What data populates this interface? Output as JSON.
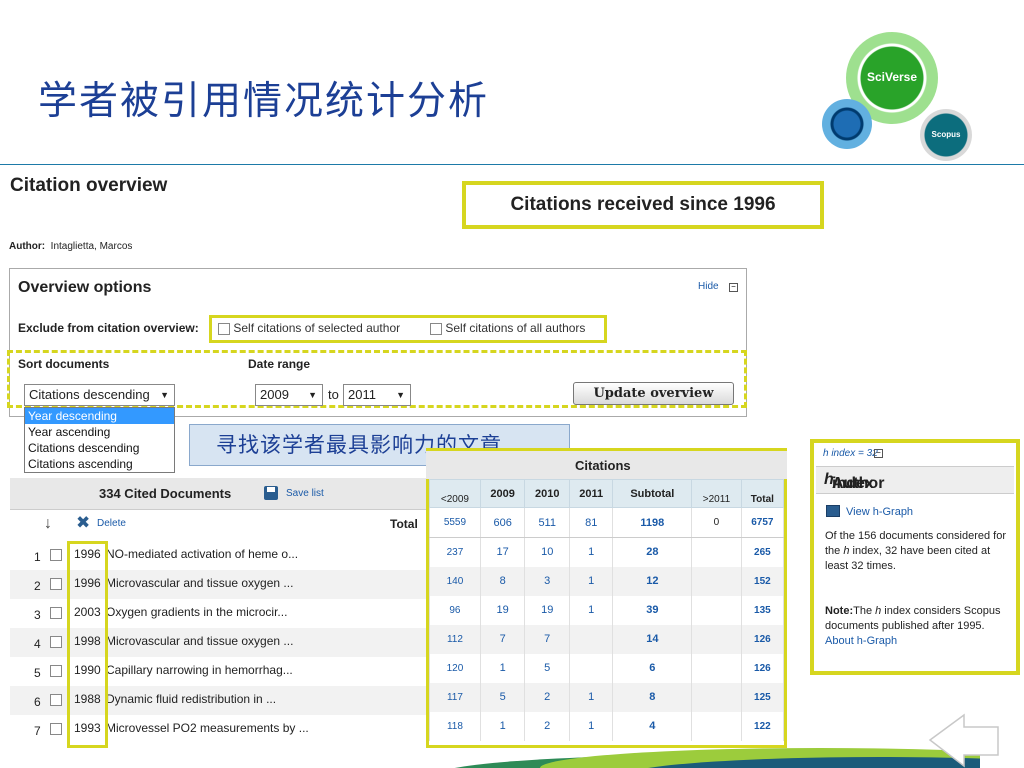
{
  "slide": {
    "title": "学者被引用情况统计分析"
  },
  "logos": {
    "big": "SciVerse",
    "small": "Scopus"
  },
  "page": {
    "heading": "Citation overview",
    "received_since": "Citations received since 1996",
    "author_label": "Author:",
    "author_name": "Intaglietta, Marcos"
  },
  "options": {
    "title": "Overview options",
    "hide_label": "Hide",
    "hide_icon": "minus-box-icon",
    "exclude_label": "Exclude from citation overview:",
    "self_selected": "Self citations of selected author",
    "self_all": "Self citations of all authors",
    "sort_label": "Sort documents",
    "date_label": "Date range",
    "sort_value": "Citations descending",
    "date_from": "2009",
    "date_to_label": "to",
    "date_to": "2011",
    "update_button": "Update overview",
    "dropdown_options": [
      "Year descending",
      "Year ascending",
      "Citations descending",
      "Citations ascending"
    ],
    "dropdown_selected_index": 0
  },
  "callout": {
    "text": "寻找该学者最具影响力的文章"
  },
  "documents": {
    "count_label": "334 Cited Documents",
    "save_label": "Save list",
    "delete_label": "Delete",
    "total_label": "Total",
    "rows": [
      {
        "num": "1",
        "year": "1996",
        "title": "NO-mediated activation of heme o..."
      },
      {
        "num": "2",
        "year": "1996",
        "title": "Microvascular and tissue oxygen ..."
      },
      {
        "num": "3",
        "year": "2003",
        "title": "Oxygen gradients in the microcir..."
      },
      {
        "num": "4",
        "year": "1998",
        "title": "Microvascular and tissue oxygen ..."
      },
      {
        "num": "5",
        "year": "1990",
        "title": "Capillary narrowing in hemorrhag..."
      },
      {
        "num": "6",
        "year": "1988",
        "title": "Dynamic fluid redistribution in ..."
      },
      {
        "num": "7",
        "year": "1993",
        "title": "Microvessel PO2 measurements by ..."
      }
    ]
  },
  "citations": {
    "caption": "Citations",
    "headers": [
      "<2009",
      "2009",
      "2010",
      "2011",
      "Subtotal",
      ">2011",
      "Total"
    ],
    "totals": [
      "5559",
      "606",
      "511",
      "81",
      "1198",
      "0",
      "6757"
    ],
    "rows": [
      [
        "237",
        "17",
        "10",
        "1",
        "28",
        "",
        "265"
      ],
      [
        "140",
        "8",
        "3",
        "1",
        "12",
        "",
        "152"
      ],
      [
        "96",
        "19",
        "19",
        "1",
        "39",
        "",
        "135"
      ],
      [
        "112",
        "7",
        "7",
        "",
        "14",
        "",
        "126"
      ],
      [
        "120",
        "1",
        "5",
        "",
        "6",
        "",
        "126"
      ],
      [
        "117",
        "5",
        "2",
        "1",
        "8",
        "",
        "125"
      ],
      [
        "118",
        "1",
        "2",
        "1",
        "4",
        "",
        "122"
      ]
    ]
  },
  "h_index": {
    "small_label": "h index = 32",
    "title_pre": "Author ",
    "title_h": "h",
    "title_post": " index",
    "view_graph": "View h-Graph",
    "desc_1": "Of the 156 documents considered for the ",
    "desc_h": "h",
    "desc_2": " index, 32 have been cited at least 32 times.",
    "note_label": "Note:",
    "note_1": "The ",
    "note_h": "h",
    "note_2": " index considers Scopus documents published after 1995.",
    "about_link": "About h-Graph"
  },
  "colors": {
    "highlight": "#d6d61f",
    "title_blue": "#1c3f95",
    "link_blue": "#1a5aa8",
    "brand_green": "#29a329"
  }
}
